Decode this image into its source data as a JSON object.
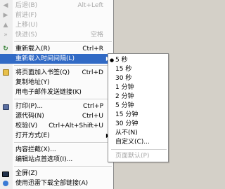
{
  "menu": {
    "items": [
      {
        "label": "后退(B)",
        "shortcut": "Alt+Left",
        "icon": "back-arrow-icon",
        "disabled": true
      },
      {
        "label": "前进(F)",
        "shortcut": "",
        "icon": "forward-arrow-icon",
        "disabled": true
      },
      {
        "label": "上移(U)",
        "shortcut": "",
        "icon": "up-arrow-icon",
        "disabled": true
      },
      {
        "label": "快进(S)",
        "shortcut": "空格",
        "icon": "fast-forward-icon",
        "disabled": true
      },
      {
        "label": "重新载入(R)",
        "shortcut": "Ctrl+R",
        "icon": "reload-icon",
        "disabled": false
      },
      {
        "label": "重新载入时间间隔(L)",
        "shortcut": "",
        "icon": "",
        "disabled": false,
        "highlighted": true,
        "submenu": true
      },
      {
        "label": "将页面加入书签(Q)",
        "shortcut": "Ctrl+D",
        "icon": "bookmark-icon",
        "disabled": false
      },
      {
        "label": "复制地址(Y)",
        "shortcut": "",
        "icon": "",
        "disabled": false
      },
      {
        "label": "用电子邮件发送链接(K)",
        "shortcut": "",
        "icon": "",
        "disabled": false
      },
      {
        "label": "打印(P)...",
        "shortcut": "Ctrl+P",
        "icon": "print-icon",
        "disabled": false
      },
      {
        "label": "源代码(N)",
        "shortcut": "Ctrl+U",
        "icon": "",
        "disabled": false
      },
      {
        "label": "校验(V)",
        "shortcut": "Ctrl+Alt+Shift+U",
        "icon": "",
        "disabled": false
      },
      {
        "label": "打开方式(E)",
        "shortcut": "",
        "icon": "",
        "disabled": false,
        "submenu": true
      },
      {
        "label": "内容拦截(X)...",
        "shortcut": "",
        "icon": "",
        "disabled": false
      },
      {
        "label": "编辑站点首选项(I)...",
        "shortcut": "",
        "icon": "",
        "disabled": false
      },
      {
        "label": "全屏(Z)",
        "shortcut": "",
        "icon": "fullscreen-icon",
        "disabled": false
      },
      {
        "label": "使用迅雷下载全部链接(A)",
        "shortcut": "",
        "icon": "download-icon",
        "disabled": false
      }
    ]
  },
  "submenu": {
    "items": [
      {
        "label": "5 秒",
        "selected": true
      },
      {
        "label": "15 秒",
        "selected": false
      },
      {
        "label": "30 秒",
        "selected": false
      },
      {
        "label": "1 分钟",
        "selected": false
      },
      {
        "label": "2 分钟",
        "selected": false
      },
      {
        "label": "5 分钟",
        "selected": false
      },
      {
        "label": "15 分钟",
        "selected": false
      },
      {
        "label": "30 分钟",
        "selected": false
      },
      {
        "label": "从不(N)",
        "selected": false
      },
      {
        "label": "自定义(C)...",
        "selected": false
      },
      {
        "label": "页面默认(P)",
        "selected": false,
        "disabled": true
      }
    ]
  },
  "colors": {
    "highlight": "#316ac5",
    "disabled_text": "#a8a8a8"
  }
}
